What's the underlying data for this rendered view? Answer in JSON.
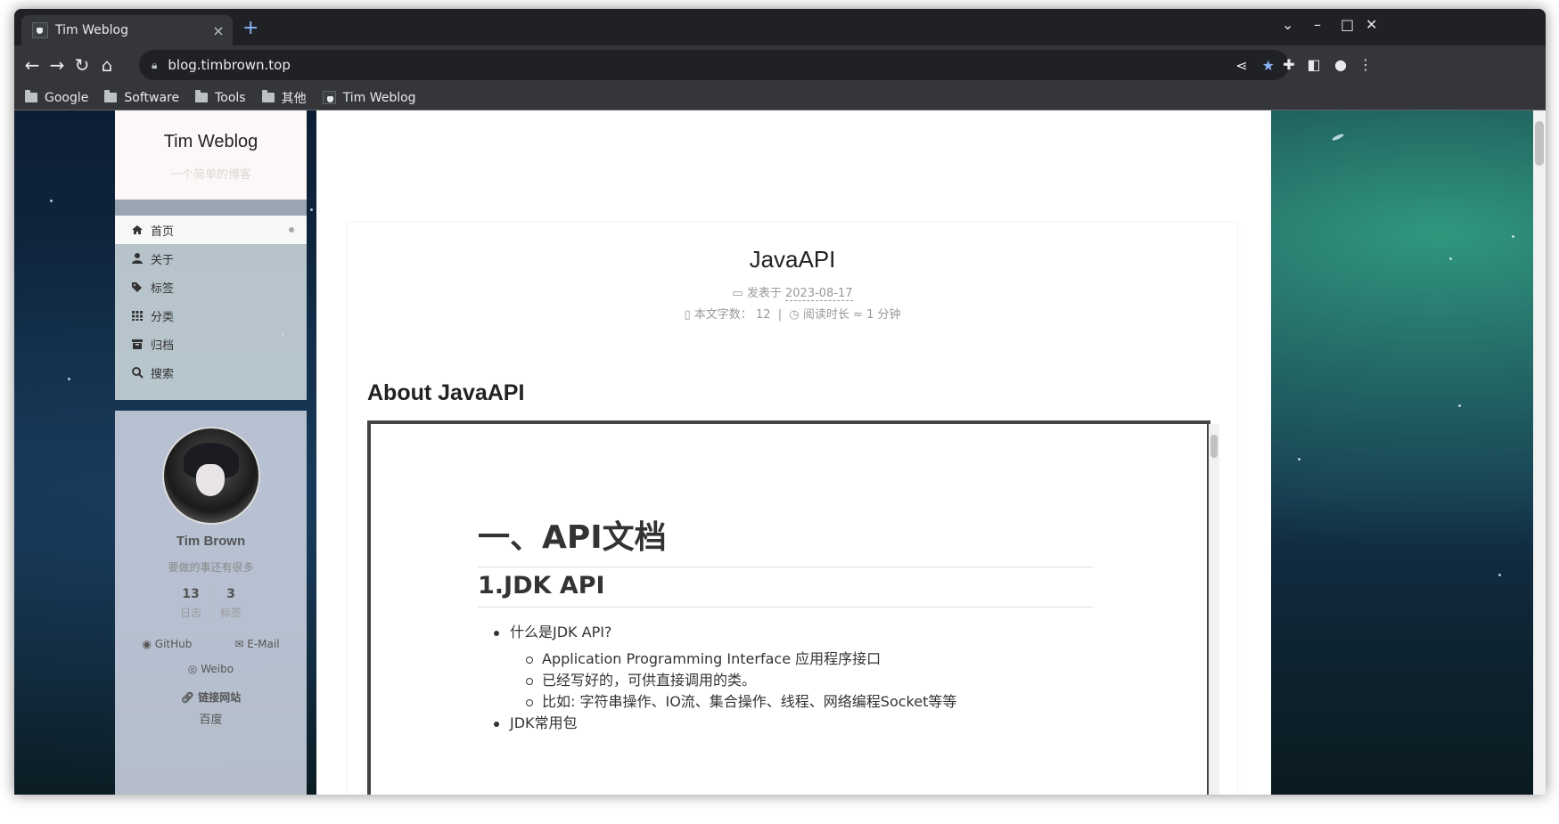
{
  "browser": {
    "tab_title": "Tim Weblog",
    "tab_close": "×",
    "new_tab": "+",
    "url": "blog.timbrown.top",
    "bookmarks": [
      {
        "label": "Google",
        "type": "folder"
      },
      {
        "label": "Software",
        "type": "folder"
      },
      {
        "label": "Tools",
        "type": "folder"
      },
      {
        "label": "其他",
        "type": "folder"
      },
      {
        "label": "Tim Weblog",
        "type": "site"
      }
    ],
    "accent": "#8ab4f8"
  },
  "sidebar": {
    "site_title": "Tim Weblog",
    "site_subtitle": "一个简单的博客",
    "menu": [
      {
        "label": "首页",
        "icon": "home-icon",
        "active": true
      },
      {
        "label": "关于",
        "icon": "user-icon",
        "active": false
      },
      {
        "label": "标签",
        "icon": "tags-icon",
        "active": false
      },
      {
        "label": "分类",
        "icon": "grid-icon",
        "active": false
      },
      {
        "label": "归档",
        "icon": "archive-icon",
        "active": false
      },
      {
        "label": "搜索",
        "icon": "search-icon",
        "active": false
      }
    ],
    "profile": {
      "name": "Tim Brown",
      "description": "要做的事还有很多",
      "posts_count": "13",
      "posts_label": "日志",
      "tags_count": "3",
      "tags_label": "标签",
      "links": [
        "GitHub",
        "E-Mail",
        "Weibo"
      ],
      "friend_links_title": "链接网站",
      "friend_links": [
        "百度"
      ]
    }
  },
  "post": {
    "title": "JavaAPI",
    "posted_label": "发表于",
    "date": "2023-08-17",
    "wordcount_label": "本文字数：",
    "wordcount": "12",
    "separator": "|",
    "reading_label": "阅读时长 ≈",
    "reading_time": "1 分钟",
    "heading": "About JavaAPI",
    "embed": {
      "h1": "一、API文档",
      "h2": "1.JDK API",
      "list": [
        {
          "level": 1,
          "text": "什么是JDK API?"
        },
        {
          "level": 2,
          "text": "Application Programming Interface 应用程序接口"
        },
        {
          "level": 2,
          "text": "已经写好的，可供直接调用的类。"
        },
        {
          "level": 2,
          "text": "比如: 字符串操作、IO流、集合操作、线程、网络编程Socket等等"
        },
        {
          "level": 1,
          "text": "JDK常用包"
        }
      ]
    }
  }
}
